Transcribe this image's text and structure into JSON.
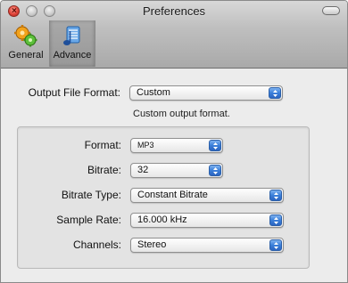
{
  "window": {
    "title": "Preferences"
  },
  "toolbar": {
    "items": [
      {
        "label": "General",
        "icon": "gears-icon"
      },
      {
        "label": "Advance",
        "icon": "music-notes-icon"
      }
    ],
    "selected": "Advance"
  },
  "output": {
    "label": "Output File Format:",
    "value": "Custom",
    "hint": "Custom output format."
  },
  "settings": {
    "format": {
      "label": "Format:",
      "value": "MP3"
    },
    "bitrate": {
      "label": "Bitrate:",
      "value": "32"
    },
    "bitrate_type": {
      "label": "Bitrate Type:",
      "value": "Constant Bitrate"
    },
    "sample_rate": {
      "label": "Sample Rate:",
      "value": "16.000 kHz"
    },
    "channels": {
      "label": "Channels:",
      "value": "Stereo"
    }
  },
  "colors": {
    "accent": "#3a7ed9",
    "close": "#e0443a"
  }
}
